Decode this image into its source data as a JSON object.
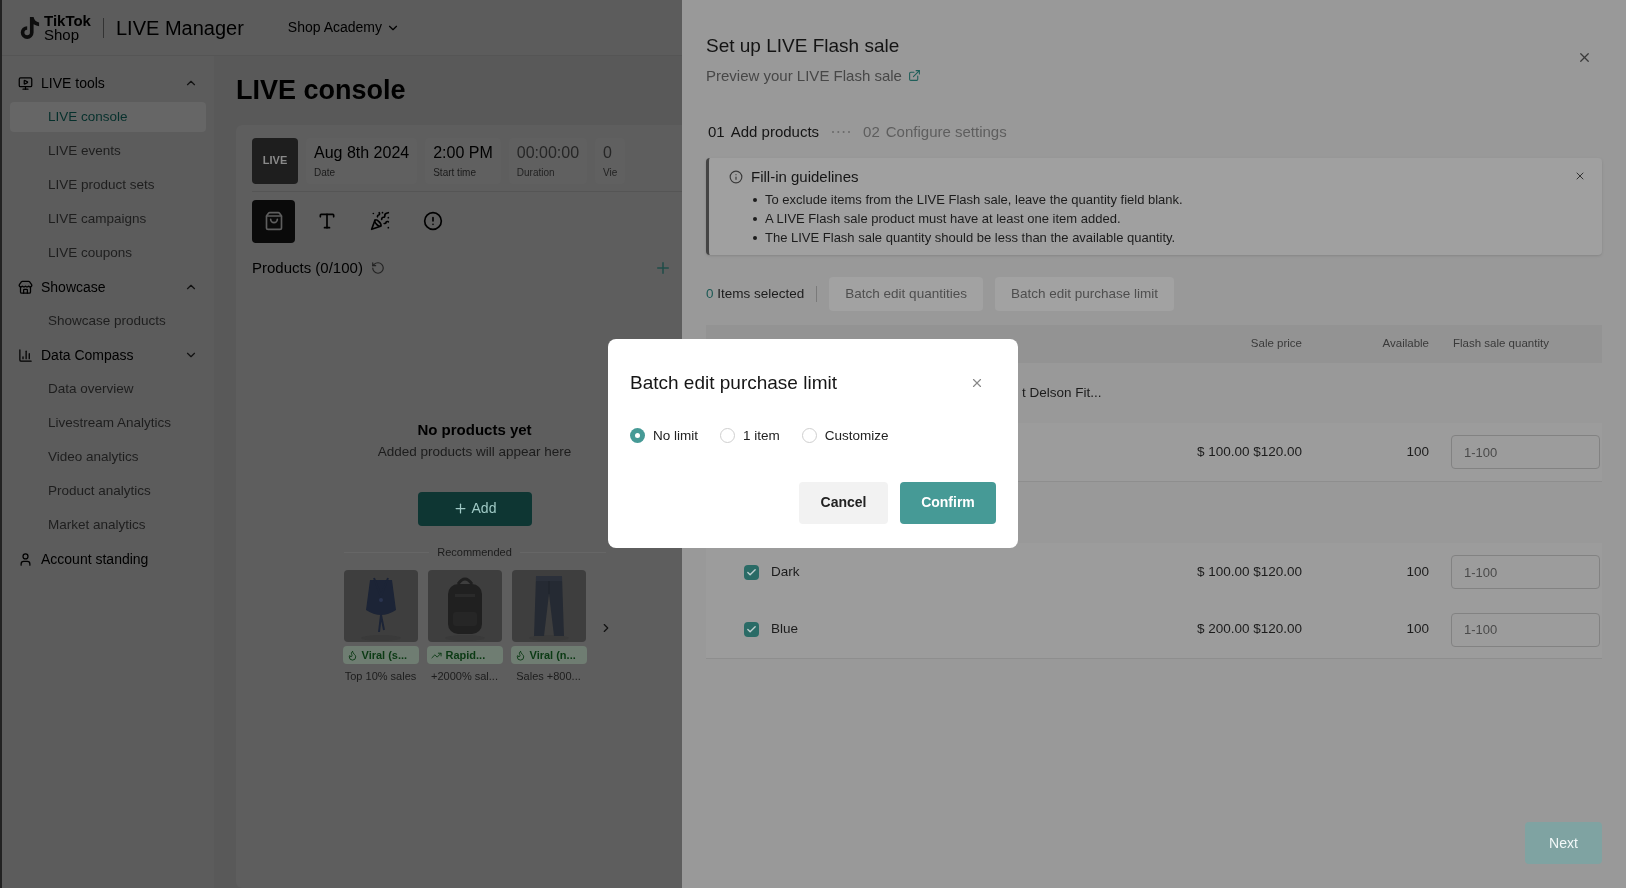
{
  "header": {
    "logo_lines": [
      "TikTok",
      "Shop"
    ],
    "app_title": "LIVE Manager",
    "menu": "Shop Academy"
  },
  "sidebar": [
    {
      "label": "LIVE tools",
      "expanded": true,
      "items": [
        {
          "label": "LIVE console",
          "selected": true
        },
        {
          "label": "LIVE events",
          "selected": false
        },
        {
          "label": "LIVE product sets",
          "selected": false
        },
        {
          "label": "LIVE campaigns",
          "selected": false
        },
        {
          "label": "LIVE coupons",
          "selected": false
        }
      ]
    },
    {
      "label": "Showcase",
      "expanded": true,
      "items": [
        {
          "label": "Showcase products",
          "selected": false
        }
      ]
    },
    {
      "label": "Data Compass",
      "expanded": false,
      "items": [
        {
          "label": "Data overview",
          "selected": false
        },
        {
          "label": "Livestream Analytics",
          "selected": false
        },
        {
          "label": "Video analytics",
          "selected": false
        },
        {
          "label": "Product analytics",
          "selected": false
        },
        {
          "label": "Market analytics",
          "selected": false
        }
      ]
    },
    {
      "label": "Account standing"
    }
  ],
  "console": {
    "title": "LIVE console",
    "thumbnail": "LIVE",
    "stats": [
      {
        "value": "Aug 8th 2024",
        "label": "Date",
        "muted": false
      },
      {
        "value": "2:00 PM",
        "label": "Start time",
        "muted": false
      },
      {
        "value": "00:00:00",
        "label": "Duration",
        "muted": true
      },
      {
        "value": "0",
        "label": "Vie",
        "muted": true
      }
    ],
    "tools": [
      {
        "selected": true
      },
      {
        "selected": false
      },
      {
        "selected": false
      },
      {
        "selected": false
      }
    ],
    "products_title": "Products (0/100)",
    "empty_title": "No products yet",
    "empty_text": "Added products will appear here",
    "add_button": "Add",
    "recommended_title": "Recommended",
    "recommended": [
      {
        "kind": "top",
        "tag": "Viral (s...",
        "caption": "Top 10% sales"
      },
      {
        "kind": "bag",
        "tag": "Rapid...",
        "caption": "+2000% sal..."
      },
      {
        "kind": "pants",
        "tag": "Viral (n...",
        "caption": "Sales +800..."
      }
    ]
  },
  "drawer": {
    "title": "Set up LIVE Flash sale",
    "subtitle": "Preview your LIVE Flash sale",
    "steps": [
      {
        "number": "01",
        "label": "Add products",
        "selected": true
      },
      {
        "number": "02",
        "label": "Configure settings",
        "selected": false
      }
    ],
    "guidelines": {
      "title": "Fill-in guidelines",
      "items": [
        "To exclude items from the LIVE Flash sale, leave the quantity field blank.",
        "A LIVE Flash sale product must have at least one item added.",
        "The LIVE Flash sale quantity should be less than the available quantity."
      ]
    },
    "selected_count": "0",
    "selected_label": "Items selected",
    "batch_buttons": [
      {
        "label": "Batch edit quantities",
        "disabled": true
      },
      {
        "label": "Batch edit purchase limit",
        "disabled": true
      }
    ],
    "columns": [
      "Sale price",
      "Available",
      "Flash sale quantity"
    ],
    "product_name": "t Delson Fit...",
    "rows": [
      {
        "kind": "variant",
        "price": "$ 100.00 $120.00",
        "available": "100",
        "placeholder": "1-100"
      },
      {
        "kind": "spacer"
      },
      {
        "kind": "variant",
        "name": "Dark",
        "checked": true,
        "price": "$ 100.00 $120.00",
        "available": "100",
        "placeholder": "1-100"
      },
      {
        "kind": "variant",
        "name": "Blue",
        "checked": true,
        "price": "$ 200.00 $120.00",
        "available": "100",
        "placeholder": "1-100"
      }
    ],
    "next_button": {
      "label": "Next",
      "disabled": true
    }
  },
  "modal": {
    "title": "Batch edit purchase limit",
    "options": [
      {
        "label": "No limit",
        "selected": true
      },
      {
        "label": "1 item",
        "selected": false
      },
      {
        "label": "Customize",
        "selected": false
      }
    ],
    "cancel": "Cancel",
    "confirm": "Confirm"
  }
}
